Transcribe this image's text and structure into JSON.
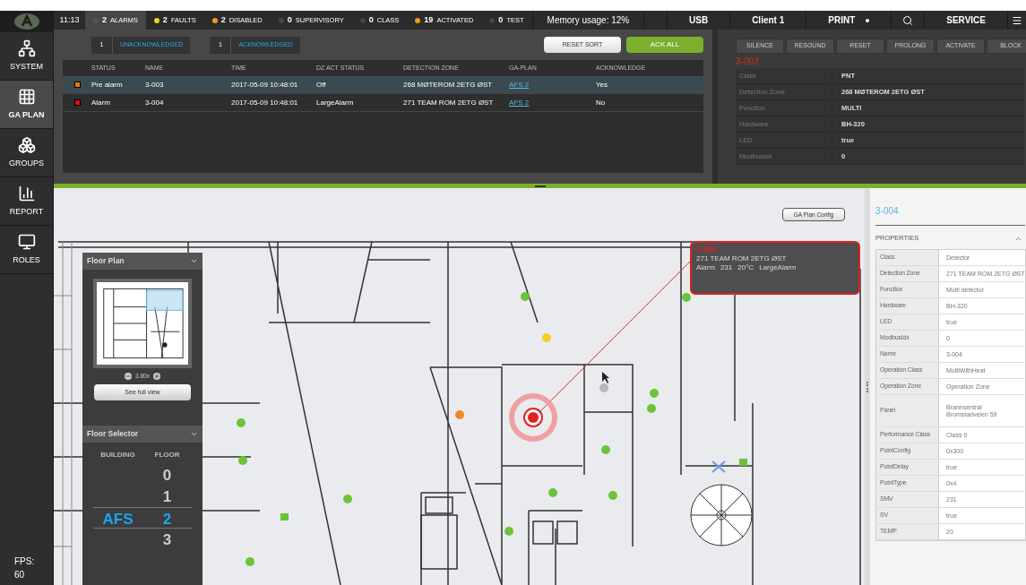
{
  "top_bar": {
    "time": "11:13",
    "status_tabs": [
      {
        "count": "2",
        "label": "ALARMS",
        "color": "#555555",
        "selected": true
      },
      {
        "count": "2",
        "label": "FAULTS",
        "color": "#f2d21b",
        "selected": false
      },
      {
        "count": "2",
        "label": "DISABLED",
        "color": "#f29a1b",
        "selected": false
      },
      {
        "count": "0",
        "label": "SUPERVISORY",
        "color": "#444444",
        "selected": false
      },
      {
        "count": "0",
        "label": "CLASS",
        "color": "#444444",
        "selected": false
      },
      {
        "count": "19",
        "label": "ACTIVATED",
        "color": "#f29a1b",
        "selected": false
      },
      {
        "count": "0",
        "label": "TEST",
        "color": "#444444",
        "selected": false
      }
    ],
    "memory": "Memory usage: 12%",
    "right_items": [
      {
        "kind": "text",
        "label": "USB"
      },
      {
        "kind": "text",
        "label": "Client 1"
      },
      {
        "kind": "print",
        "label": "PRINT"
      },
      {
        "kind": "search"
      },
      {
        "kind": "text",
        "label": "SERVICE"
      },
      {
        "kind": "menu"
      }
    ]
  },
  "sidebar": {
    "items": [
      {
        "kind": "system",
        "label": "SYSTEM",
        "selected": false
      },
      {
        "kind": "gaplan",
        "label": "GA PLAN",
        "selected": true
      },
      {
        "kind": "groups",
        "label": "GROUPS",
        "selected": false
      },
      {
        "kind": "report",
        "label": "REPORT",
        "selected": false
      },
      {
        "kind": "roles",
        "label": "ROLES",
        "selected": false
      }
    ],
    "fps": "FPS: 60"
  },
  "alarm_list": {
    "counters": [
      {
        "count": "1",
        "label": "UNACKNOWLEDGED"
      },
      {
        "count": "1",
        "label": "ACKNOWLEDGED"
      }
    ],
    "reset_sort": "RESET SORT",
    "ack_all": "ACK ALL",
    "columns": [
      "STATUS",
      "NAME",
      "TIME",
      "DZ ACT STATUS",
      "DETECTION ZONE",
      "GA-PLAN",
      "ACKNOWLEDGE"
    ],
    "rows": [
      {
        "status": "Pre alarm",
        "color": "#f07a10",
        "name": "3-003",
        "time": "2017-05-09 10:48:01",
        "dz_act_status": "Off",
        "detection_zone": "268 MØTEROM 2ETG ØST",
        "ga_plan": "AFS 2",
        "acknowledge": "Yes",
        "selected": true
      },
      {
        "status": "Alarm",
        "color": "#e01010",
        "name": "3-004",
        "time": "2017-05-09 10:48:01",
        "dz_act_status": "LargeAlarm",
        "detection_zone": "271 TEAM ROM 2ETG ØST",
        "ga_plan": "AFS 2",
        "acknowledge": "No",
        "selected": false
      }
    ]
  },
  "alarm_details": {
    "buttons": [
      "SILENCE",
      "RESOUND",
      "RESET",
      "PROLONG",
      "ACTIVATE",
      "BLOCK"
    ],
    "title": "3-003",
    "properties": [
      [
        "Class",
        "PNT"
      ],
      [
        "Detection Zone",
        "268 MØTEROM 2ETG ØST"
      ],
      [
        "Function",
        "MULTI"
      ],
      [
        "Hardware",
        "BH-320"
      ],
      [
        "LED",
        "true"
      ],
      [
        "ModbusIdx",
        "0"
      ]
    ]
  },
  "map": {
    "config_button": "GA Plan Config",
    "callout": {
      "title": "3-004",
      "zone": "271 TEAM ROM 2ETG ØST",
      "details": [
        "Alarm",
        "231",
        "20°C",
        "LargeAlarm"
      ]
    },
    "floor_plan": {
      "title": "Floor Plan",
      "zoom": "3.80x",
      "full_view": "See full view"
    },
    "floor_selector": {
      "title": "Floor Selector",
      "building_header": "BUILDING",
      "floor_header": "FLOOR",
      "floors": [
        {
          "floor": "0",
          "selected": false
        },
        {
          "floor": "1",
          "selected": false
        },
        {
          "building": "AFS",
          "floor": "2",
          "selected": true
        },
        {
          "floor": "3",
          "selected": false
        }
      ]
    }
  },
  "properties_panel": {
    "title": "3-004",
    "header": "PROPERTIES",
    "rows": [
      [
        "Class",
        "Detector"
      ],
      [
        "Detection Zone",
        "271 TEAM ROM 2ETG ØST"
      ],
      [
        "Function",
        "Multi detector"
      ],
      [
        "Hardware",
        "BH-320"
      ],
      [
        "LED",
        "true"
      ],
      [
        "ModbusIdx",
        "0"
      ],
      [
        "Name",
        "3-004"
      ],
      [
        "Operation Class",
        "MultiWithHeat"
      ],
      [
        "Operation Zone",
        "Operation Zone"
      ],
      [
        "Panel",
        "Brannsentral Bromstadveien 59"
      ],
      [
        "Performance Class",
        "Class 0"
      ],
      [
        "PointConfig",
        "0x300"
      ],
      [
        "PointDelay",
        "true"
      ],
      [
        "PointType",
        "0x4"
      ],
      [
        "SMV",
        "231"
      ],
      [
        "SV",
        "true"
      ],
      [
        "TEMP",
        "20"
      ]
    ]
  }
}
